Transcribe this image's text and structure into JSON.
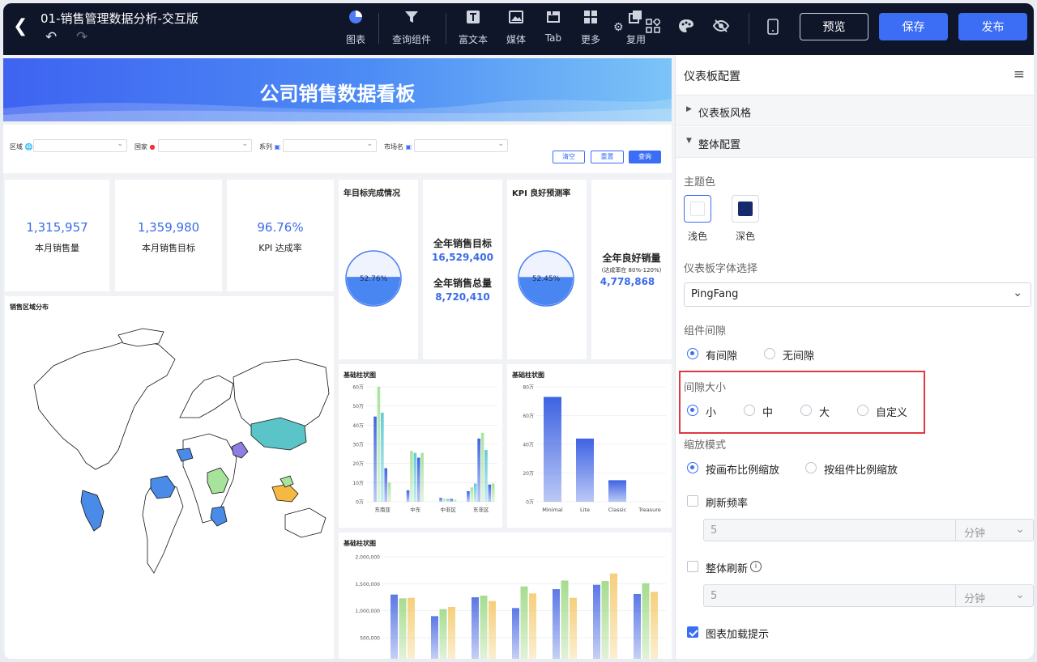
{
  "header": {
    "title": "01-销售管理数据分析-交互版",
    "tools": [
      {
        "label": "图表",
        "icon": "pie-chart-icon"
      },
      {
        "label": "查询组件",
        "icon": "filter-icon"
      },
      {
        "label": "富文本",
        "icon": "text-icon"
      },
      {
        "label": "媒体",
        "icon": "image-icon"
      },
      {
        "label": "Tab",
        "icon": "tab-icon"
      },
      {
        "label": "更多",
        "icon": "grid-icon"
      },
      {
        "label": "复用",
        "icon": "copy-icon"
      }
    ],
    "preview_label": "预览",
    "save_label": "保存",
    "publish_label": "发布"
  },
  "dashboard": {
    "banner_title": "公司销售数据看板",
    "filters": [
      {
        "label": "区域",
        "icon": "globe-icon"
      },
      {
        "label": "国家",
        "icon": "pin-icon"
      },
      {
        "label": "系列",
        "icon": "series-icon"
      },
      {
        "label": "市场名",
        "icon": "abc-icon"
      }
    ],
    "clear_label": "清空",
    "reset_label": "重置",
    "query_label": "查询",
    "kpis": [
      {
        "value": "1,315,957",
        "label": "本月销售量"
      },
      {
        "value": "1,359,980",
        "label": "本月销售目标"
      },
      {
        "value": "96.76%",
        "label": "KPI 达成率"
      }
    ],
    "target_card": {
      "title": "年目标完成情况",
      "percent": "52.76%",
      "fill": 0.5276
    },
    "totals_card": {
      "target_label": "全年销售目标",
      "target_value": "16,529,400",
      "total_label": "全年销售总量",
      "total_value": "8,720,410"
    },
    "kpi_forecast_card": {
      "title": "KPI 良好预测率",
      "percent": "52.45%",
      "fill": 0.5245
    },
    "good_sales_card": {
      "label": "全年良好销量",
      "note": "(达成率在 80%-120%)",
      "value": "4,778,868"
    },
    "map_card": {
      "title": "销售区域分布"
    },
    "bar_titles": [
      "基础柱状图",
      "基础柱状图",
      "基础柱状图"
    ]
  },
  "chart_data": [
    {
      "type": "bar",
      "title": "基础柱状图",
      "categories": [
        "东南亚",
        "中东",
        "中非区",
        "东非区"
      ],
      "ylim": [
        0,
        600000
      ],
      "yticks": [
        "0万",
        "10万",
        "20万",
        "30万",
        "40万",
        "50万",
        "60万"
      ],
      "colors": [
        "#3e63e3",
        "#a8e39c",
        "#62c9d7"
      ],
      "series": [
        {
          "values": [
            445000,
            60000,
            20000,
            55000
          ]
        },
        {
          "values": [
            600000,
            265000,
            15000,
            75000
          ]
        },
        {
          "values": [
            465000,
            255000,
            15000,
            95000
          ]
        },
        {
          "values": [
            175000,
            230000,
            15000,
            330000
          ]
        },
        {
          "values": [
            100000,
            255000,
            10000,
            360000
          ]
        },
        {
          "values": [
            0,
            0,
            0,
            270000
          ]
        },
        {
          "values": [
            0,
            0,
            0,
            90000
          ]
        },
        {
          "values": [
            0,
            0,
            0,
            95000
          ]
        }
      ]
    },
    {
      "type": "bar",
      "title": "基础柱状图",
      "categories": [
        "Minimal",
        "Lite",
        "Classic",
        "Treasure"
      ],
      "values": [
        730000,
        440000,
        150000,
        0
      ],
      "ylim": [
        0,
        800000
      ],
      "yticks": [
        "0万",
        "20万",
        "40万",
        "60万",
        "80万"
      ],
      "colors": [
        "#3e63e3"
      ]
    },
    {
      "type": "bar",
      "title": "基础柱状图",
      "ylim": [
        500000,
        2000000
      ],
      "yticks": [
        "500,000",
        "1,000,000",
        "1,500,000",
        "2,000,000"
      ],
      "colors": [
        "#5b78e6",
        "#a6dc8f",
        "#f5cf7a"
      ],
      "series": [
        {
          "values": [
            1300000,
            900000,
            1250000,
            1050000,
            1400000,
            1480000,
            1310000
          ]
        },
        {
          "values": [
            1230000,
            1030000,
            1280000,
            1450000,
            1560000,
            1550000,
            1510000
          ]
        },
        {
          "values": [
            1240000,
            1070000,
            1180000,
            1320000,
            1240000,
            1690000,
            1350000
          ]
        }
      ]
    }
  ],
  "panel": {
    "title": "仪表板配置",
    "sections": {
      "style": "仪表板风格",
      "overall": "整体配置"
    },
    "theme": {
      "label": "主题色",
      "light": "浅色",
      "dark": "深色"
    },
    "font": {
      "label": "仪表板字体选择",
      "value": "PingFang"
    },
    "gap": {
      "label": "组件间隙",
      "with": "有间隙",
      "without": "无间隙"
    },
    "gap_size": {
      "label": "间隙大小",
      "options": [
        "小",
        "中",
        "大",
        "自定义"
      ]
    },
    "zoom": {
      "label": "缩放模式",
      "canvas": "按画布比例缩放",
      "component": "按组件比例缩放"
    },
    "refresh": {
      "label": "刷新频率",
      "value": "5",
      "unit": "分钟"
    },
    "global_refresh": {
      "label": "整体刷新",
      "value": "5",
      "unit": "分钟"
    },
    "loading_hint": {
      "label": "图表加载提示"
    }
  }
}
